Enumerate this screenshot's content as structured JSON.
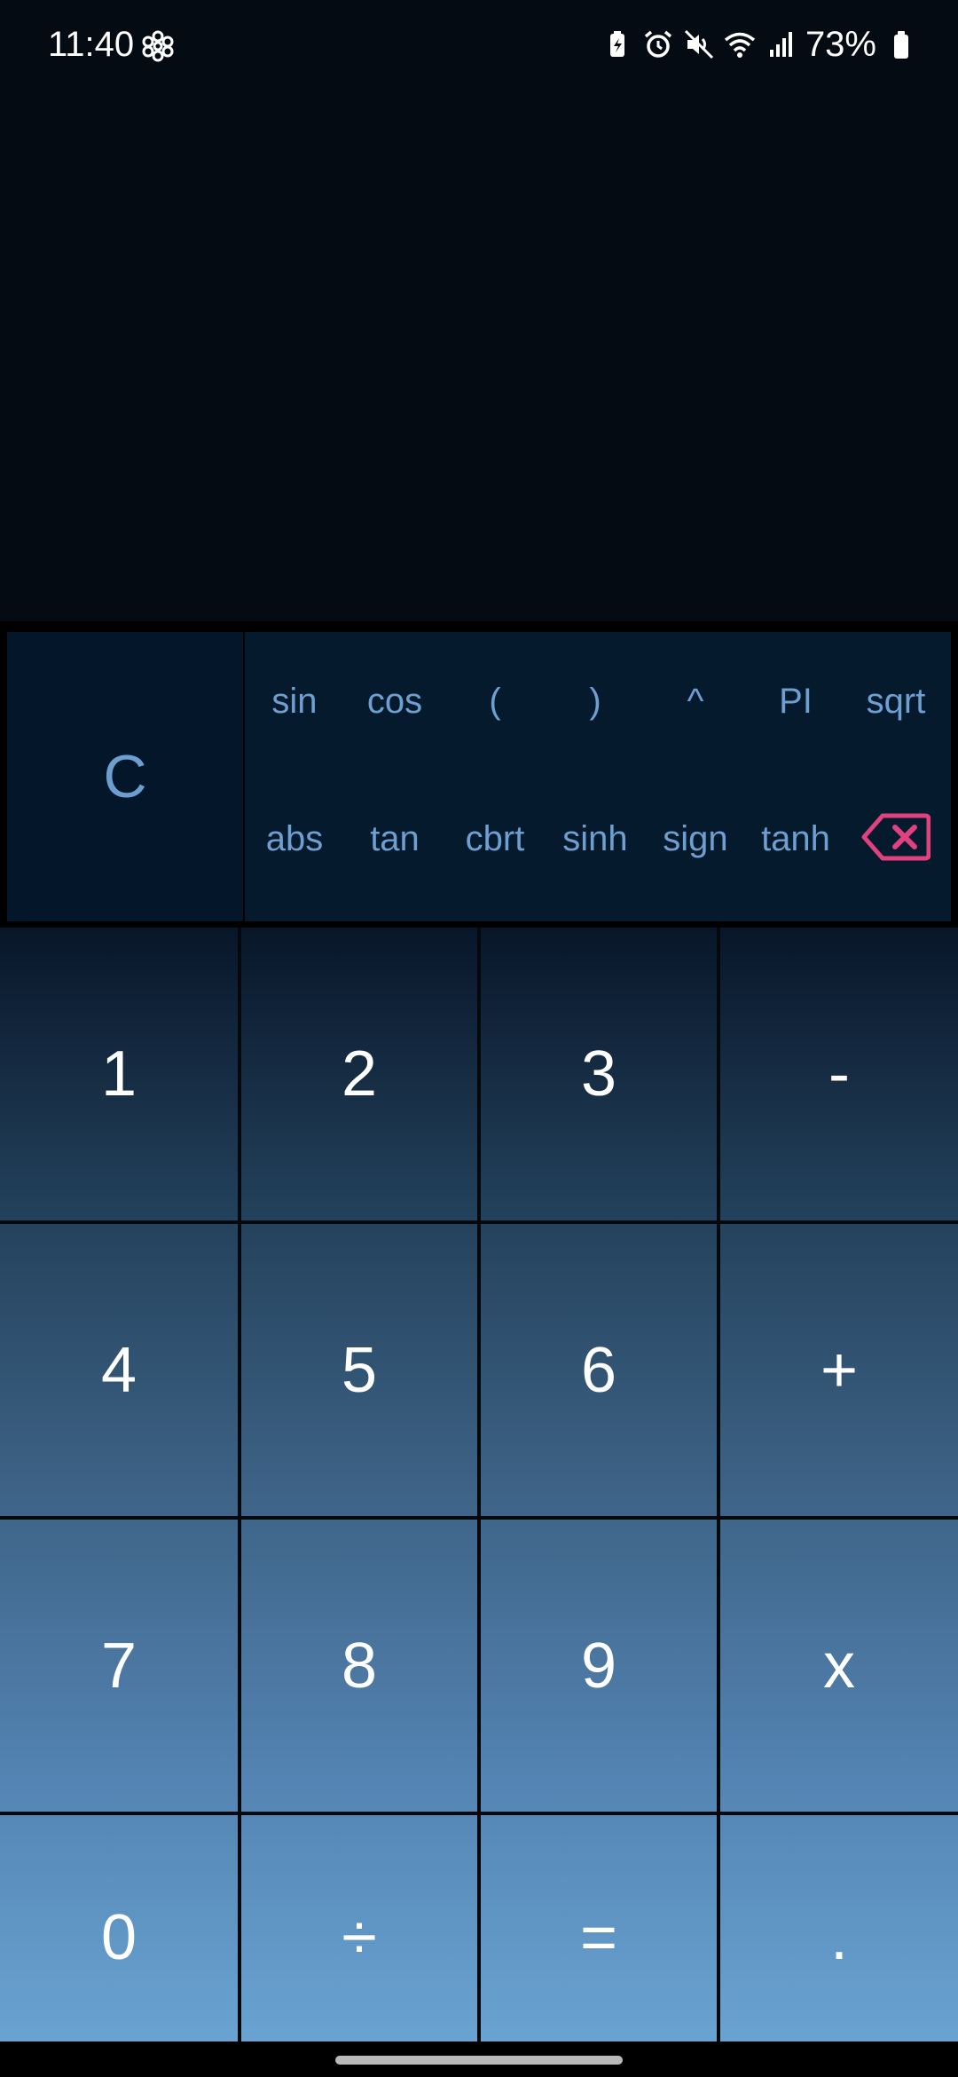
{
  "status_bar": {
    "time": "11:40",
    "battery_percent": "73%",
    "icons": [
      "flower-icon",
      "battery-saver-icon",
      "alarm-icon",
      "mute-icon",
      "wifi-icon",
      "signal-icon",
      "battery-icon"
    ]
  },
  "scientific": {
    "clear_label": "C",
    "row1": [
      "sin",
      "cos",
      "(",
      ")",
      "^",
      "PI",
      "sqrt"
    ],
    "row2": [
      "abs",
      "tan",
      "cbrt",
      "sinh",
      "sign",
      "tanh"
    ],
    "backspace_icon": "backspace-icon"
  },
  "keypad": {
    "rows": [
      [
        "1",
        "2",
        "3",
        "-"
      ],
      [
        "4",
        "5",
        "6",
        "+"
      ],
      [
        "7",
        "8",
        "9",
        "x"
      ],
      [
        "0",
        "÷",
        "=",
        "."
      ]
    ]
  },
  "colors": {
    "accent_text": "#6f9fd0",
    "delete_icon": "#e0417f",
    "background": "#050b12"
  }
}
